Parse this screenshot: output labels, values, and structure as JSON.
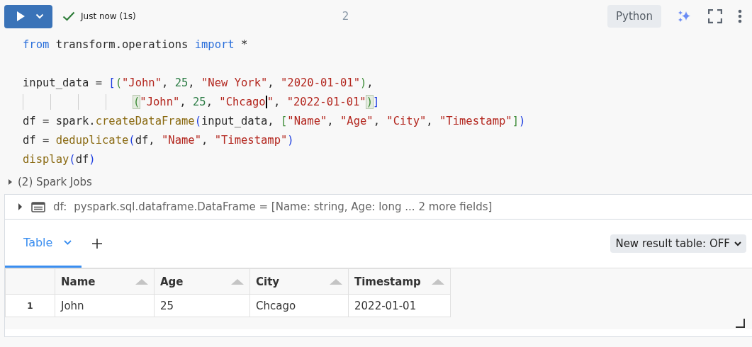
{
  "toolbar": {
    "status": "Just now (1s)",
    "succeeded": true,
    "cell_number": "2",
    "language": "Python"
  },
  "code_lines": [
    {
      "tokens": [
        {
          "text": "from",
          "kind": "keyword"
        },
        {
          "text": " transform.operations ",
          "kind": "plain"
        },
        {
          "text": "import",
          "kind": "keyword"
        },
        {
          "text": " *",
          "kind": "plain"
        }
      ]
    },
    {
      "kind": "blank"
    },
    {
      "tokens": [
        {
          "text": "input_data = ",
          "kind": "plain"
        },
        {
          "text": "[",
          "kind": "bracket1"
        },
        {
          "text": "(",
          "kind": "bracket2"
        },
        {
          "text": "\"John\"",
          "kind": "string"
        },
        {
          "text": ", ",
          "kind": "plain"
        },
        {
          "text": "25",
          "kind": "number"
        },
        {
          "text": ", ",
          "kind": "plain"
        },
        {
          "text": "\"New York\"",
          "kind": "string"
        },
        {
          "text": ", ",
          "kind": "plain"
        },
        {
          "text": "\"2020-01-01\"",
          "kind": "string"
        },
        {
          "text": ")",
          "kind": "bracket2"
        },
        {
          "text": ",",
          "kind": "plain"
        }
      ]
    },
    {
      "kind": "continuation",
      "tokens": [
        {
          "text": "(",
          "kind": "bracket2",
          "matched": true
        },
        {
          "text": "\"John\"",
          "kind": "string"
        },
        {
          "text": ", ",
          "kind": "plain"
        },
        {
          "text": "25",
          "kind": "number"
        },
        {
          "text": ", ",
          "kind": "plain"
        },
        {
          "text": "\"Chcago",
          "kind": "string",
          "cursor": true
        },
        {
          "text": "\"",
          "kind": "string"
        },
        {
          "text": ", ",
          "kind": "plain"
        },
        {
          "text": "\"2022-01-01\"",
          "kind": "string"
        },
        {
          "text": ")",
          "kind": "bracket2",
          "matched": true
        },
        {
          "text": "]",
          "kind": "bracket1"
        }
      ]
    },
    {
      "tokens": [
        {
          "text": "df = spark.",
          "kind": "plain"
        },
        {
          "text": "createDataFrame",
          "kind": "function"
        },
        {
          "text": "(",
          "kind": "bracket1"
        },
        {
          "text": "input_data, ",
          "kind": "plain"
        },
        {
          "text": "[",
          "kind": "bracket2"
        },
        {
          "text": "\"Name\"",
          "kind": "string"
        },
        {
          "text": ", ",
          "kind": "plain"
        },
        {
          "text": "\"Age\"",
          "kind": "string"
        },
        {
          "text": ", ",
          "kind": "plain"
        },
        {
          "text": "\"City\"",
          "kind": "string"
        },
        {
          "text": ", ",
          "kind": "plain"
        },
        {
          "text": "\"Timestamp\"",
          "kind": "string"
        },
        {
          "text": "]",
          "kind": "bracket2"
        },
        {
          "text": ")",
          "kind": "bracket1"
        }
      ]
    },
    {
      "tokens": [
        {
          "text": "df = ",
          "kind": "plain"
        },
        {
          "text": "deduplicate",
          "kind": "function"
        },
        {
          "text": "(",
          "kind": "bracket1"
        },
        {
          "text": "df, ",
          "kind": "plain"
        },
        {
          "text": "\"Name\"",
          "kind": "string"
        },
        {
          "text": ", ",
          "kind": "plain"
        },
        {
          "text": "\"Timestamp\"",
          "kind": "string"
        },
        {
          "text": ")",
          "kind": "bracket1"
        }
      ]
    },
    {
      "tokens": [
        {
          "text": "display",
          "kind": "function"
        },
        {
          "text": "(",
          "kind": "bracket1"
        },
        {
          "text": "df",
          "kind": "plain"
        },
        {
          "text": ")",
          "kind": "bracket1"
        }
      ]
    }
  ],
  "spark_jobs": {
    "label": "(2) Spark Jobs",
    "expanded": false
  },
  "dataframe": {
    "name": "df:",
    "schema": "pyspark.sql.dataframe.DataFrame = [Name: string, Age: long ... 2 more fields]",
    "expanded": false
  },
  "tabs": [
    {
      "label": "Table",
      "selected": true
    }
  ],
  "new_result_table": "New result table: OFF",
  "table": {
    "columns": [
      "Name",
      "Age",
      "City",
      "Timestamp"
    ],
    "rows": [
      {
        "index": "1",
        "cells": [
          "John",
          "25",
          "Chcago",
          "2022-01-01"
        ]
      }
    ]
  }
}
